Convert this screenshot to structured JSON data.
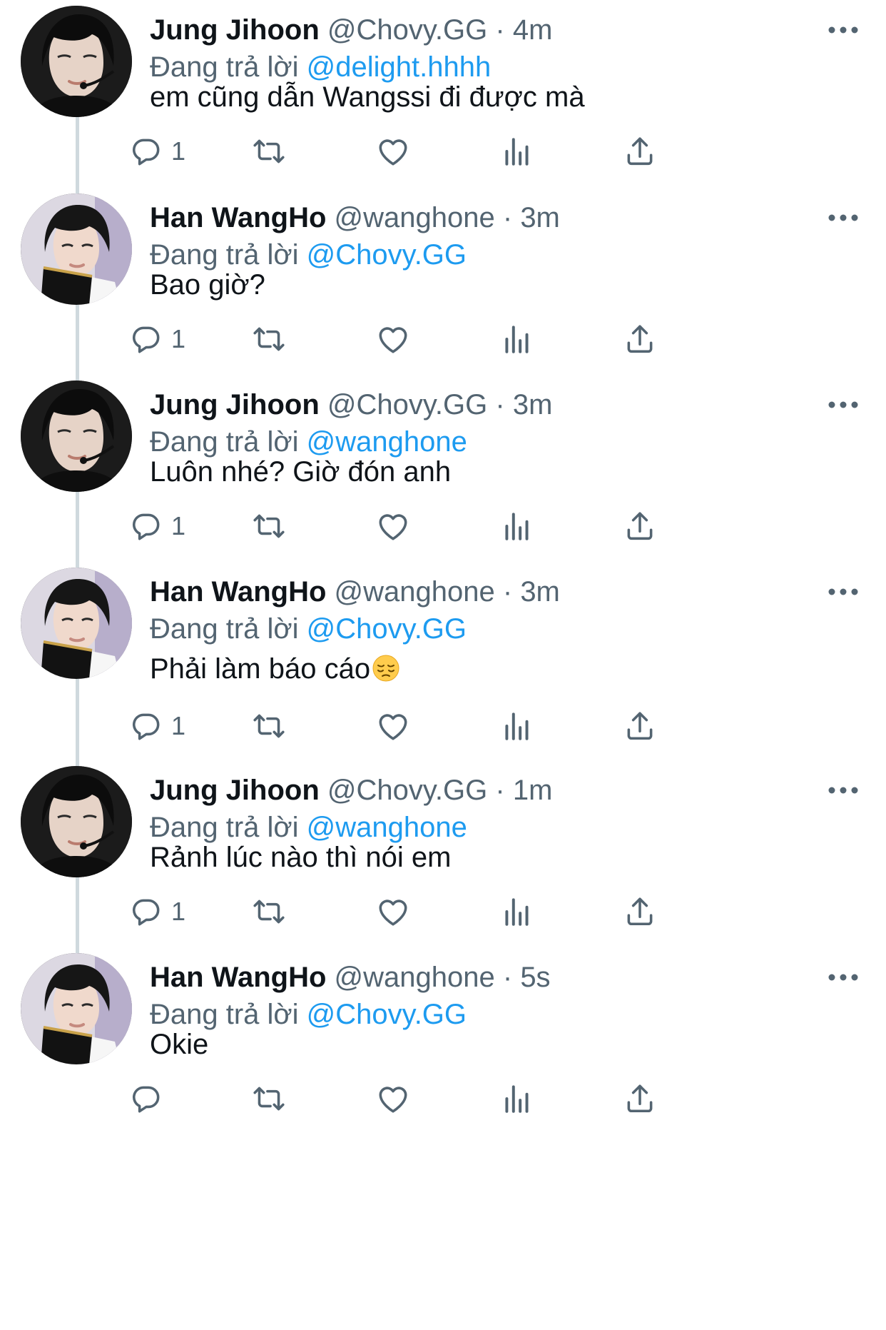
{
  "thread": {
    "colors": {
      "text": "#0f1419",
      "secondary": "#536471",
      "link": "#1d9bf0",
      "thread_line": "#cfd9de"
    },
    "tweets": [
      {
        "author": "jung",
        "display_name": "Jung Jihoon",
        "handle": "@Chovy.GG",
        "separator": "·",
        "time": "4m",
        "reply_prefix": "Đang trả lời",
        "reply_to": "@delight.hhhh",
        "text": "em cũng dẫn Wangssi đi được mà",
        "reply_count": "1",
        "has_emoji": false
      },
      {
        "author": "han",
        "display_name": "Han WangHo",
        "handle": "@wanghone",
        "separator": "·",
        "time": "3m",
        "reply_prefix": "Đang trả lời",
        "reply_to": "@Chovy.GG",
        "text": "Bao giờ?",
        "reply_count": "1",
        "has_emoji": false
      },
      {
        "author": "jung",
        "display_name": "Jung Jihoon",
        "handle": "@Chovy.GG",
        "separator": "·",
        "time": "3m",
        "reply_prefix": "Đang trả lời",
        "reply_to": "@wanghone",
        "text": "Luôn nhé? Giờ đón anh",
        "reply_count": "1",
        "has_emoji": false
      },
      {
        "author": "han",
        "display_name": "Han WangHo",
        "handle": "@wanghone",
        "separator": "·",
        "time": "3m",
        "reply_prefix": "Đang trả lời",
        "reply_to": "@Chovy.GG",
        "text": "Phải làm báo cáo",
        "reply_count": "1",
        "has_emoji": true,
        "emoji": "pensive-face-emoji"
      },
      {
        "author": "jung",
        "display_name": "Jung Jihoon",
        "handle": "@Chovy.GG",
        "separator": "·",
        "time": "1m",
        "reply_prefix": "Đang trả lời",
        "reply_to": "@wanghone",
        "text": "Rảnh lúc nào thì nói em",
        "reply_count": "1",
        "has_emoji": false
      },
      {
        "author": "han",
        "display_name": "Han WangHo",
        "handle": "@wanghone",
        "separator": "·",
        "time": "5s",
        "reply_prefix": "Đang trả lời",
        "reply_to": "@Chovy.GG",
        "text": "Okie",
        "reply_count": "",
        "has_emoji": false
      }
    ],
    "action_icons": [
      "reply-icon",
      "retweet-icon",
      "like-icon",
      "views-icon",
      "share-icon"
    ],
    "more_icon": "more-options-icon"
  }
}
